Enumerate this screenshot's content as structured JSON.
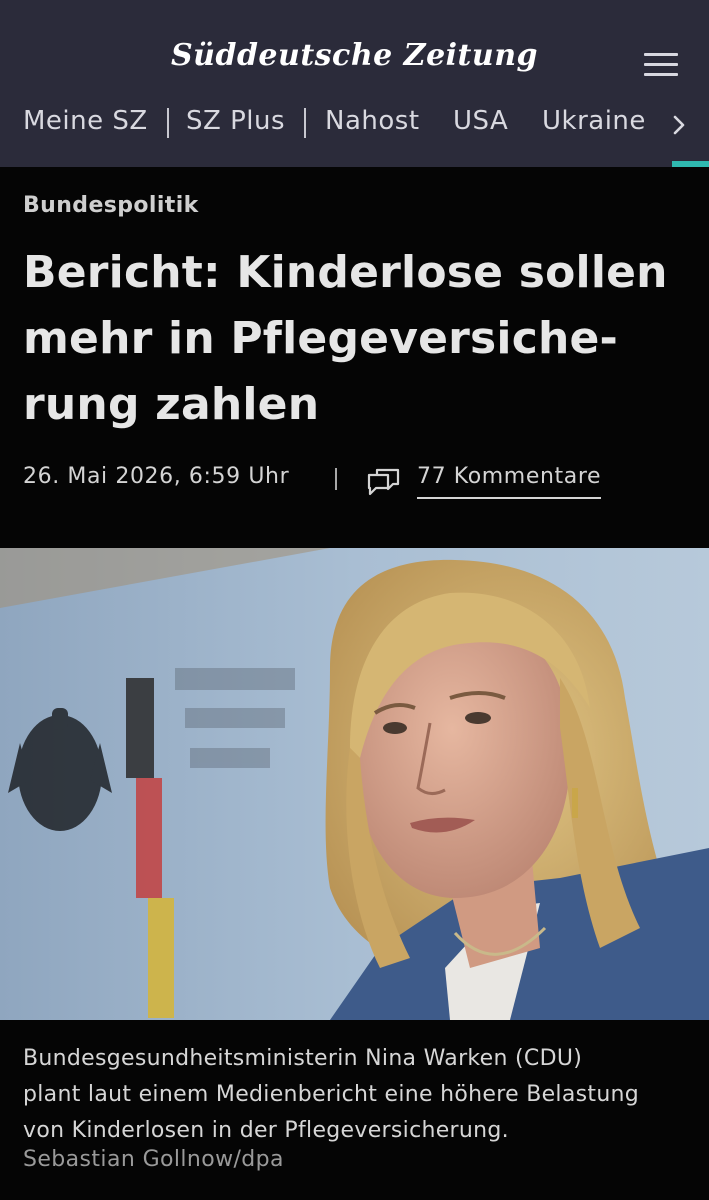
{
  "header": {
    "logo_text": "Süddeutsche Zeitung",
    "nav": [
      "Meine SZ",
      "SZ Plus",
      "Nahost",
      "USA",
      "Ukraine"
    ],
    "colors": {
      "background": "#2b2b3a",
      "accent": "#2fb9b0"
    }
  },
  "article": {
    "kicker": "Bundespolitik",
    "headline_lines": [
      "Bericht: Kinderlose sollen",
      "mehr in Pflegeversiche-",
      "rung zahlen"
    ],
    "date": "26. Mai 2026, 6:59 Uhr",
    "comments_label": "77 Kommentare",
    "image_alt": "Nina Warken speaking at a press conference",
    "caption_lines": [
      "Bundesgesundheitsministerin Nina Warken (CDU)",
      "plant laut einem Medienbericht eine höhere Belastung",
      "von Kinderlosen in der Pflegeversicherung."
    ],
    "credit": "Sebastian Gollnow/dpa"
  },
  "icons": [
    "menu-icon",
    "chevron-right-icon",
    "comment-icon"
  ]
}
